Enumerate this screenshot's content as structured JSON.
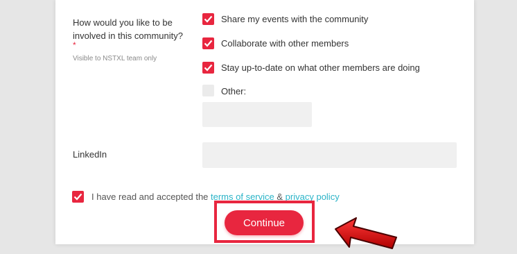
{
  "form": {
    "question_line1": "How would you like to be",
    "question_line2": "involved in this community?",
    "required_mark": "*",
    "hint": "Visible to NSTXL team only",
    "options": [
      {
        "label": "Share my events with the community",
        "checked": true
      },
      {
        "label": "Collaborate with other members",
        "checked": true
      },
      {
        "label": "Stay up-to-date on what other members are doing",
        "checked": true
      },
      {
        "label": "Other:",
        "checked": false
      }
    ],
    "other_value": "",
    "linkedin_label": "LinkedIn",
    "linkedin_value": "",
    "terms_prefix": "I have read and accepted the ",
    "terms_link": "terms of service",
    "terms_and": " & ",
    "privacy_link": "privacy policy",
    "terms_checked": true,
    "continue_label": "Continue"
  },
  "colors": {
    "accent": "#e8263f",
    "link": "#2bb3c7",
    "field_bg": "#f0f0f0"
  }
}
